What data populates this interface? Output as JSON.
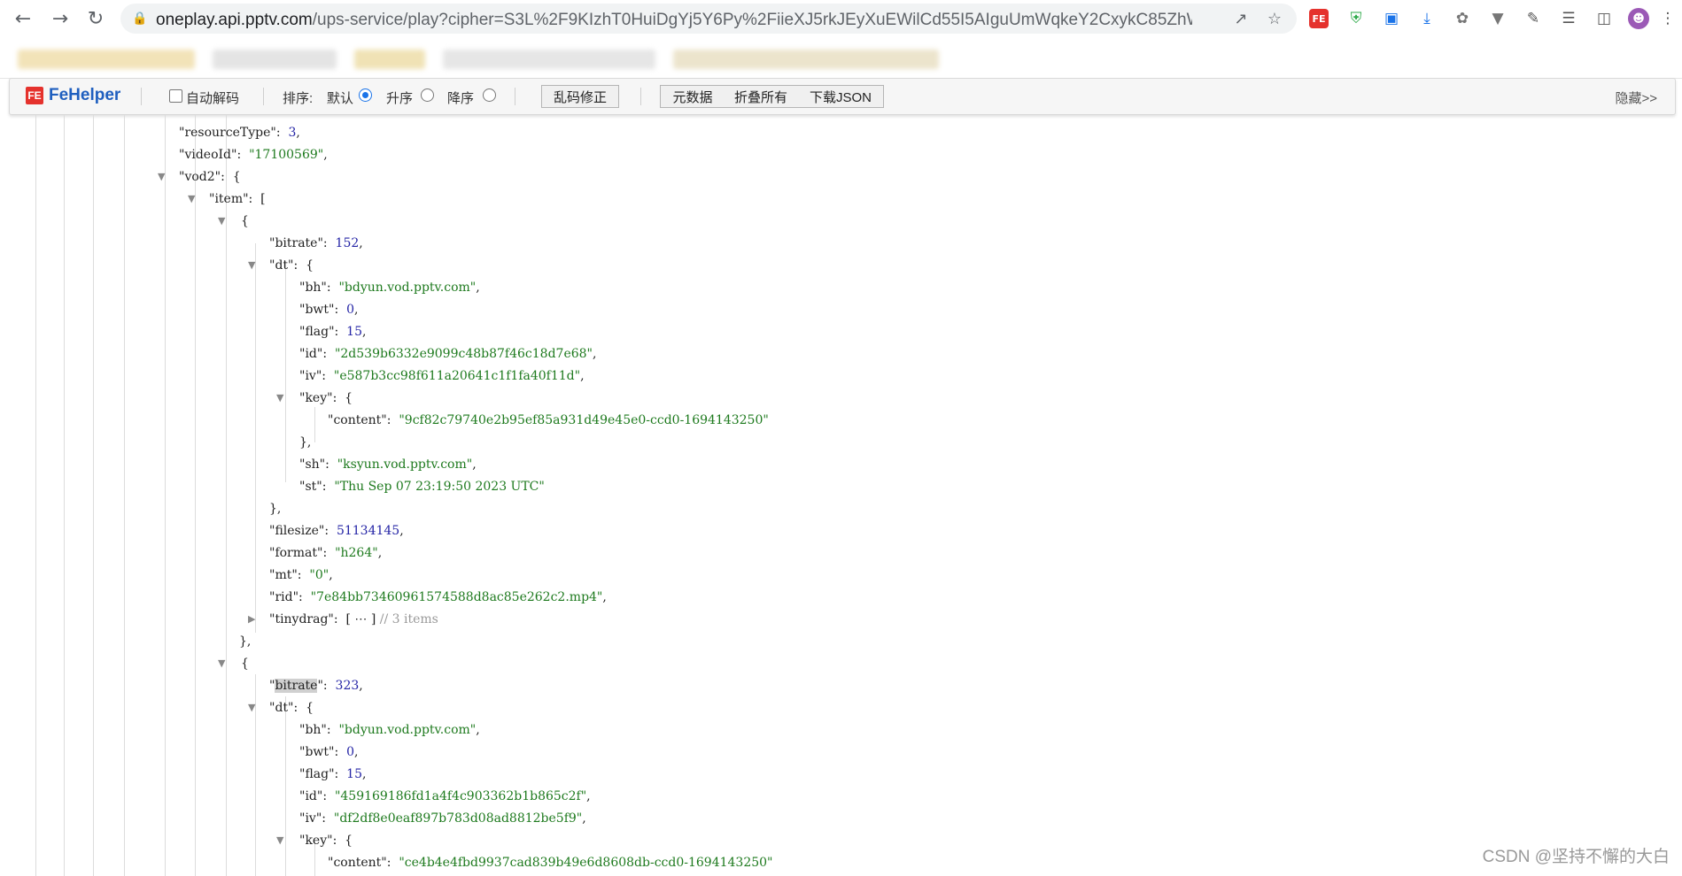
{
  "browser": {
    "url_host": "oneplay.api.pptv.com",
    "url_rest": "/ups-service/play?cipher=S3L%2F9KIzhT0HuiDgYj5Y6Py%2FiieXJ5rkJEyXuEWilCd55I5AIguUmWqkeY2CxykC85ZhWUngJ..."
  },
  "toolbar": {
    "logo": "FeHelper",
    "auto_decode_label": "自动解码",
    "sort_label": "排序:",
    "sort_default": "默认",
    "sort_asc": "升序",
    "sort_desc": "降序",
    "fix_encoding": "乱码修正",
    "raw_data": "元数据",
    "collapse_all": "折叠所有",
    "download_json": "下载JSON",
    "hide": "隐藏>>"
  },
  "json": {
    "resourceType": "3",
    "videoId": "\"17100569\"",
    "item1": {
      "bitrate": "152",
      "bh": "\"bdyun.vod.pptv.com\"",
      "bwt": "0",
      "flag": "15",
      "id": "\"2d539b6332e9099c48b87f46c18d7e68\"",
      "iv": "\"e587b3cc98f611a20641c1f1fa40f11d\"",
      "content": "\"9cf82c79740e2b95ef85a931d49e45e0-ccd0-1694143250\"",
      "sh": "\"ksyun.vod.pptv.com\"",
      "st": "\"Thu Sep 07 23:19:50 2023 UTC\"",
      "filesize": "51134145",
      "format": "\"h264\"",
      "mt": "\"0\"",
      "rid": "\"7e84bb73460961574588d8ac85e262c2.mp4\"",
      "tinydrag_comment": "// 3 items"
    },
    "item2": {
      "bitrate": "323",
      "bh": "\"bdyun.vod.pptv.com\"",
      "bwt": "0",
      "flag": "15",
      "id": "\"459169186fd1a4f4c903362b1b865c2f\"",
      "iv": "\"df2df8e0eaf897b783d08ad8812be5f9\"",
      "content": "\"ce4b4e4fbd9937cad839b49e6d8608db-ccd0-1694143250\""
    }
  },
  "watermark": "CSDN @坚持不懈的大白"
}
